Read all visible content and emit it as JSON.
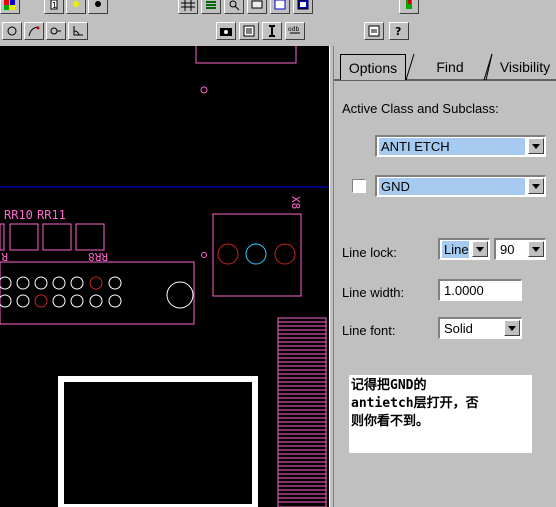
{
  "tabs": [
    {
      "label": "Options"
    },
    {
      "label": "Find"
    },
    {
      "label": "Visibility"
    }
  ],
  "active_class_label": "Active Class and Subclass:",
  "class_select": {
    "value": "ANTI ETCH"
  },
  "subclass_select": {
    "value": "GND"
  },
  "line_lock": {
    "label": "Line lock:",
    "mode": "Line",
    "angle": "90"
  },
  "line_width": {
    "label": "Line width:",
    "value": "1.0000"
  },
  "line_font": {
    "label": "Line font:",
    "value": "Solid"
  },
  "annotation": {
    "line1": "记得把GND的",
    "line2": "antietch层打开，否",
    "line3": "则你看不到。"
  },
  "canvas": {
    "refdes_rr10": "RR10",
    "refdes_rr11": "RR11",
    "refdes_rr8": "RR8",
    "refdes_x8": "X8",
    "refdes_r": "R"
  },
  "colors": {
    "board_bg": "#000000",
    "outline": "#ff66cc",
    "ratsnest": "#0000ff",
    "pad_red": "#cc2222",
    "pad_white": "#ffffff",
    "pad_cyan": "#33ccff",
    "selection": "#a6caf0"
  },
  "icons": [
    "color-icon",
    "info-icon",
    "light-icon",
    "grid-icon",
    "layers-icon",
    "zoom-icon",
    "snapshot-icon",
    "fit-icon",
    "arc-icon",
    "slide-icon",
    "corner-icon",
    "camera-icon",
    "report-icon",
    "measure-icon",
    "db-icon",
    "properties-icon",
    "help-icon"
  ]
}
